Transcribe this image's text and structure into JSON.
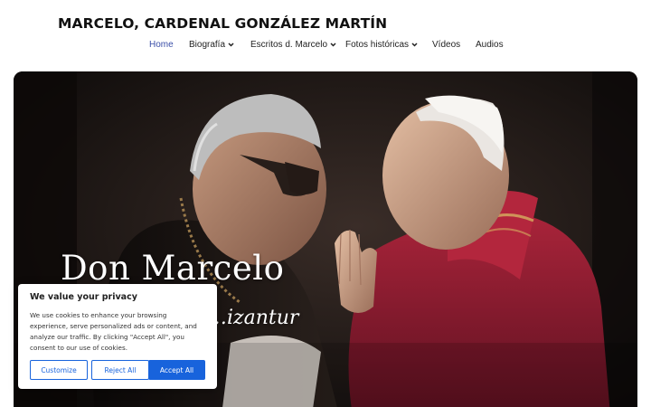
{
  "site": {
    "title": "MARCELO, CARDENAL GONZÁLEZ MARTÍN"
  },
  "nav": {
    "items": [
      {
        "label": "Home",
        "active": true,
        "dropdown": false
      },
      {
        "label": "Biografía",
        "active": false,
        "dropdown": true
      },
      {
        "label": "Escritos d. Marcelo",
        "active": false,
        "dropdown": true
      },
      {
        "label": "Fotos históricas",
        "active": false,
        "dropdown": true
      },
      {
        "label": "Vídeos",
        "active": false,
        "dropdown": false
      },
      {
        "label": "Audios",
        "active": false,
        "dropdown": false
      }
    ],
    "active_color": "#3b4fa8",
    "chevron_icon": "chevron-down-icon"
  },
  "hero": {
    "title": "Don Marcelo",
    "subtitle": "…izantur",
    "image": "historical-photo-cardinal-and-pope"
  },
  "cookie": {
    "title": "We value your privacy",
    "text": "We use cookies to enhance your browsing experience, serve personalized ads or content, and analyze our traffic. By clicking \"Accept All\", you consent to our use of cookies.",
    "buttons": {
      "customize": "Customize",
      "reject": "Reject All",
      "accept": "Accept All"
    },
    "accent_color": "#1863dc"
  }
}
